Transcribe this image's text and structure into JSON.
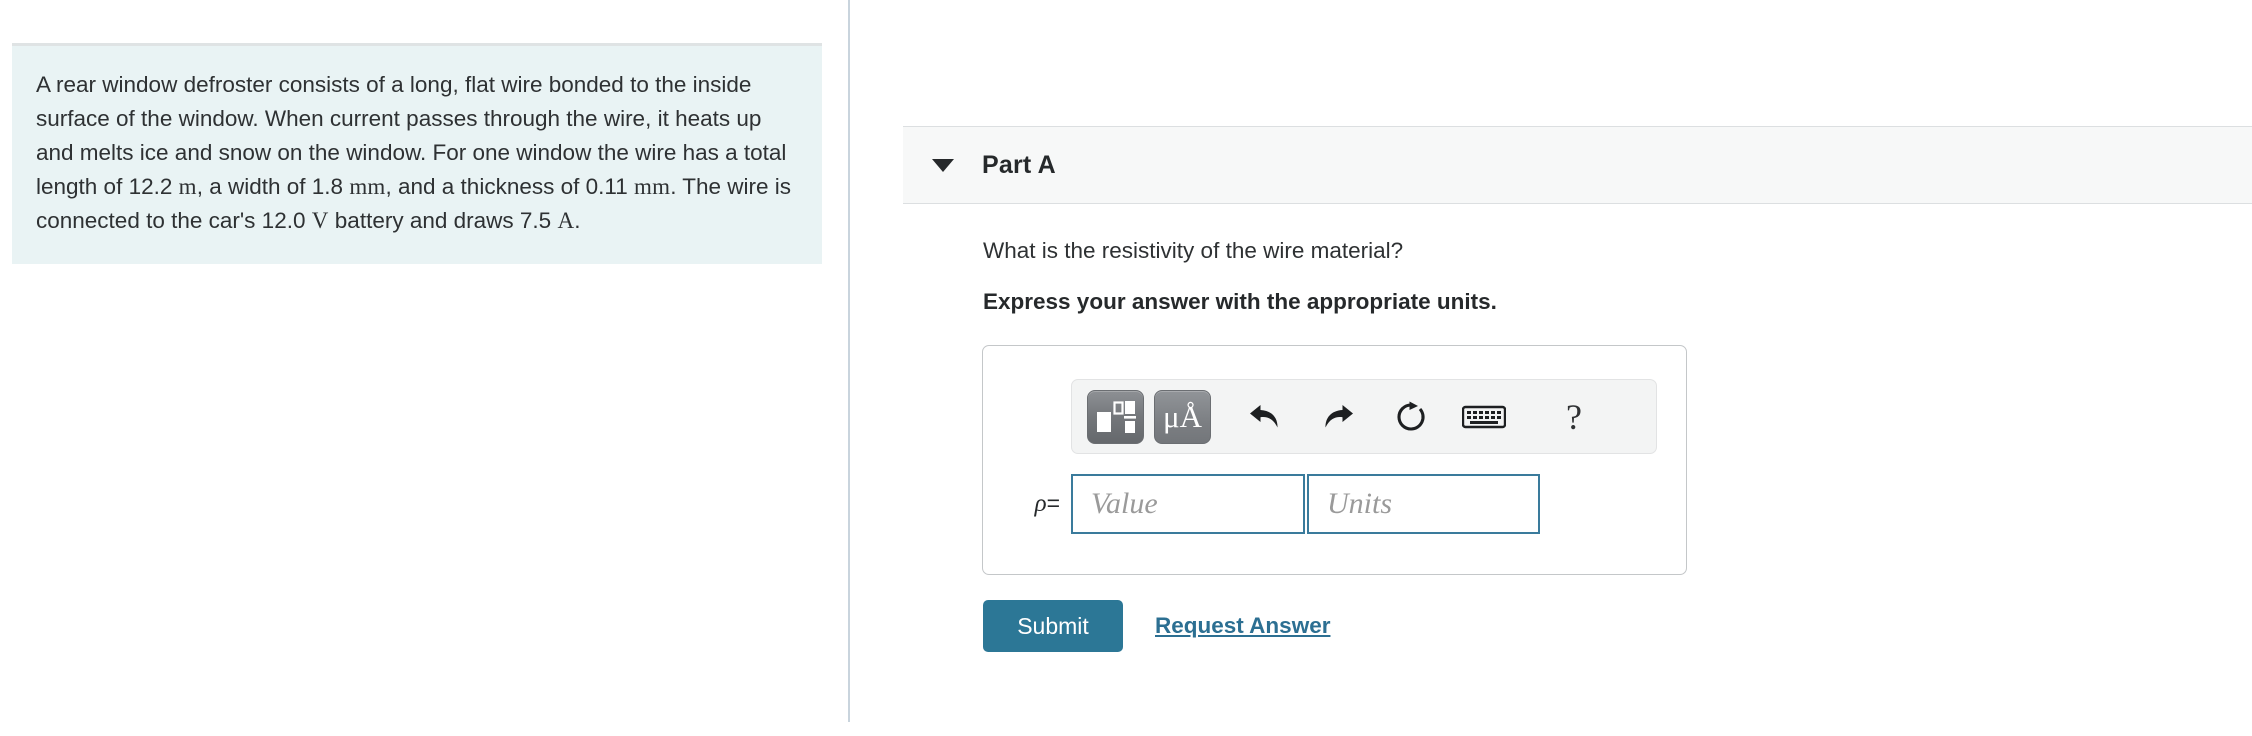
{
  "problem": {
    "segments": [
      {
        "text": "A rear window defroster consists of a long, flat wire bonded to the inside surface of the window. When current passes through the wire, it heats up and melts ice and snow on the window. For one window the wire has a total length of 12.2 ",
        "style": "plain"
      },
      {
        "text": "m",
        "style": "math"
      },
      {
        "text": ", a width of 1.8 ",
        "style": "plain"
      },
      {
        "text": "mm",
        "style": "math"
      },
      {
        "text": ", and a thickness of 0.11 ",
        "style": "plain"
      },
      {
        "text": "mm",
        "style": "math"
      },
      {
        "text": ". The wire is connected to the car's 12.0 ",
        "style": "plain"
      },
      {
        "text": "V",
        "style": "math"
      },
      {
        "text": " battery and draws 7.5 ",
        "style": "plain"
      },
      {
        "text": "A",
        "style": "math"
      },
      {
        "text": ".",
        "style": "plain"
      }
    ],
    "full_text": "A rear window defroster consists of a long, flat wire bonded to the inside surface of the window. When current passes through the wire, it heats up and melts ice and snow on the window. For one window the wire has a total length of 12.2 m, a width of 1.8 mm, and a thickness of 0.11 mm. The wire is connected to the car's 12.0 V battery and draws 7.5 A.",
    "background_color": "#e9f3f4",
    "given_values": {
      "length": "12.2 m",
      "width": "1.8 mm",
      "thickness": "0.11 mm",
      "voltage": "12.0 V",
      "current": "7.5 A"
    }
  },
  "part": {
    "title": "Part A",
    "expanded": true,
    "caret_icon": "chevron-down-icon",
    "question": "What is the resistivity of the wire material?",
    "instruction": "Express your answer with the appropriate units."
  },
  "answer_toolbar": {
    "buttons": [
      {
        "name": "math-template-button",
        "icon": "math-template-icon",
        "label": "",
        "active": true
      },
      {
        "name": "units-button",
        "icon": "micro-angstrom-icon",
        "label": "μÅ",
        "active": true
      },
      {
        "name": "undo-button",
        "icon": "undo-arrow-icon",
        "label": ""
      },
      {
        "name": "redo-button",
        "icon": "redo-arrow-icon",
        "label": ""
      },
      {
        "name": "reset-button",
        "icon": "reset-circular-arrow-icon",
        "label": ""
      },
      {
        "name": "keyboard-button",
        "icon": "keyboard-icon",
        "label": ""
      },
      {
        "name": "help-button",
        "icon": "question-mark-icon",
        "label": "?"
      }
    ]
  },
  "answer_entry": {
    "variable_label": "ρ",
    "equals_sign": "=",
    "value_placeholder": "Value",
    "value": "",
    "units_placeholder": "Units",
    "units": "",
    "field_border_color": "#3a7b9c"
  },
  "actions": {
    "submit_label": "Submit",
    "submit_color": "#2c7796",
    "request_answer_label": "Request Answer",
    "link_color": "#2c6f92"
  }
}
